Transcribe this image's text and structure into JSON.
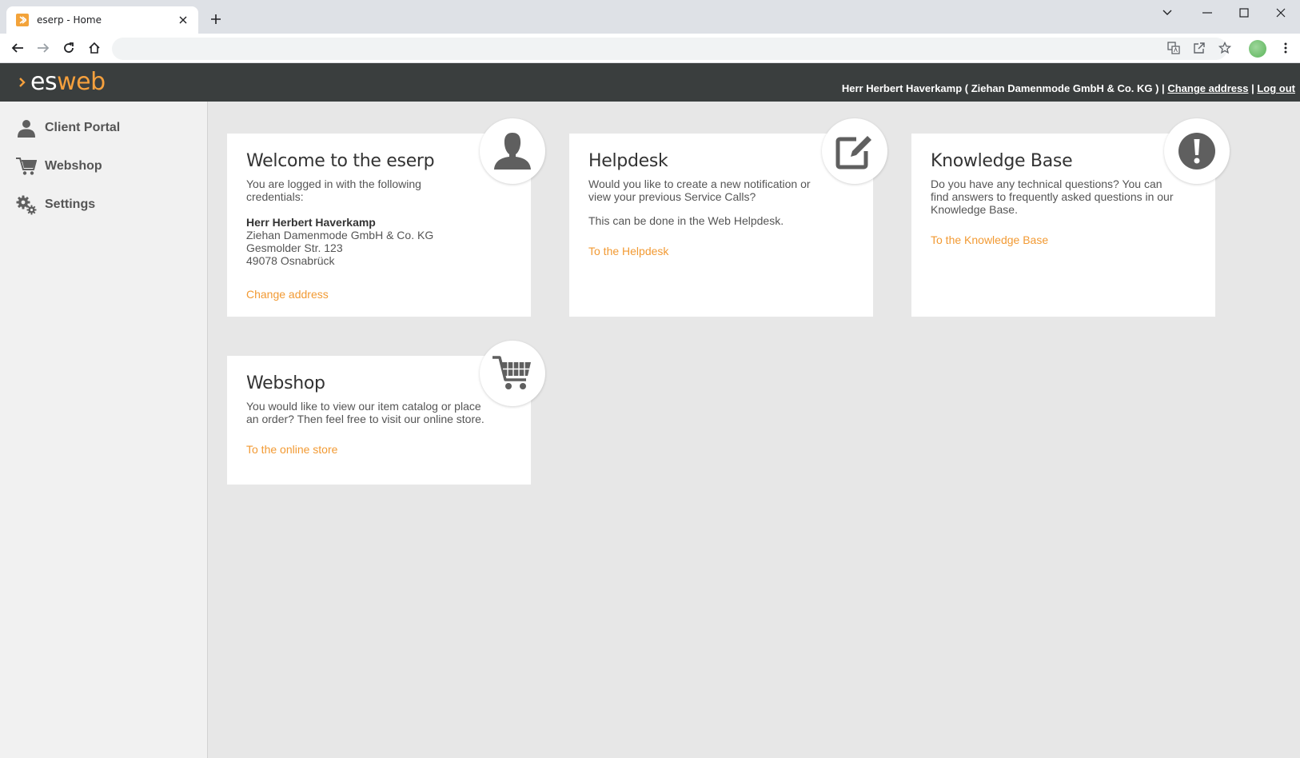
{
  "browser": {
    "tab_title": "eserp - Home"
  },
  "header": {
    "logo_es": "es",
    "logo_web": "web",
    "user_text": "Herr Herbert Haverkamp ( Ziehan Damenmode GmbH & Co. KG ) | ",
    "change_address": "Change address",
    "separator": " | ",
    "logout": "Log out"
  },
  "sidebar": {
    "items": [
      {
        "label": "Client Portal",
        "icon": "person-icon"
      },
      {
        "label": "Webshop",
        "icon": "cart-icon"
      },
      {
        "label": "Settings",
        "icon": "gears-icon"
      }
    ]
  },
  "cards": {
    "welcome": {
      "title": "Welcome to the eserp",
      "intro": "You are logged in with the following credentials:",
      "name": "Herr Herbert Haverkamp",
      "company": "Ziehan Damenmode GmbH & Co. KG",
      "street": "Gesmolder Str. 123",
      "city": "49078 Osnabrück",
      "link": "Change address"
    },
    "helpdesk": {
      "title": "Helpdesk",
      "text1": "Would you like to create a new notification or view your previous Service Calls?",
      "text2": "This can be done in the Web Helpdesk.",
      "link": "To the Helpdesk"
    },
    "knowledge": {
      "title": "Knowledge Base",
      "text": "Do you have any technical questions? You can find answers to frequently asked questions in our Knowledge Base.",
      "link": "To the Knowledge Base"
    },
    "webshop": {
      "title": "Webshop",
      "text": "You would like to view our item catalog or place an order? Then feel free to visit our online store.",
      "link": "To the online store"
    }
  },
  "colors": {
    "accent": "#f29a33",
    "header_bg": "#3a3e3e",
    "page_bg": "#e7e7e7",
    "icon_gray": "#5f5f5f"
  }
}
